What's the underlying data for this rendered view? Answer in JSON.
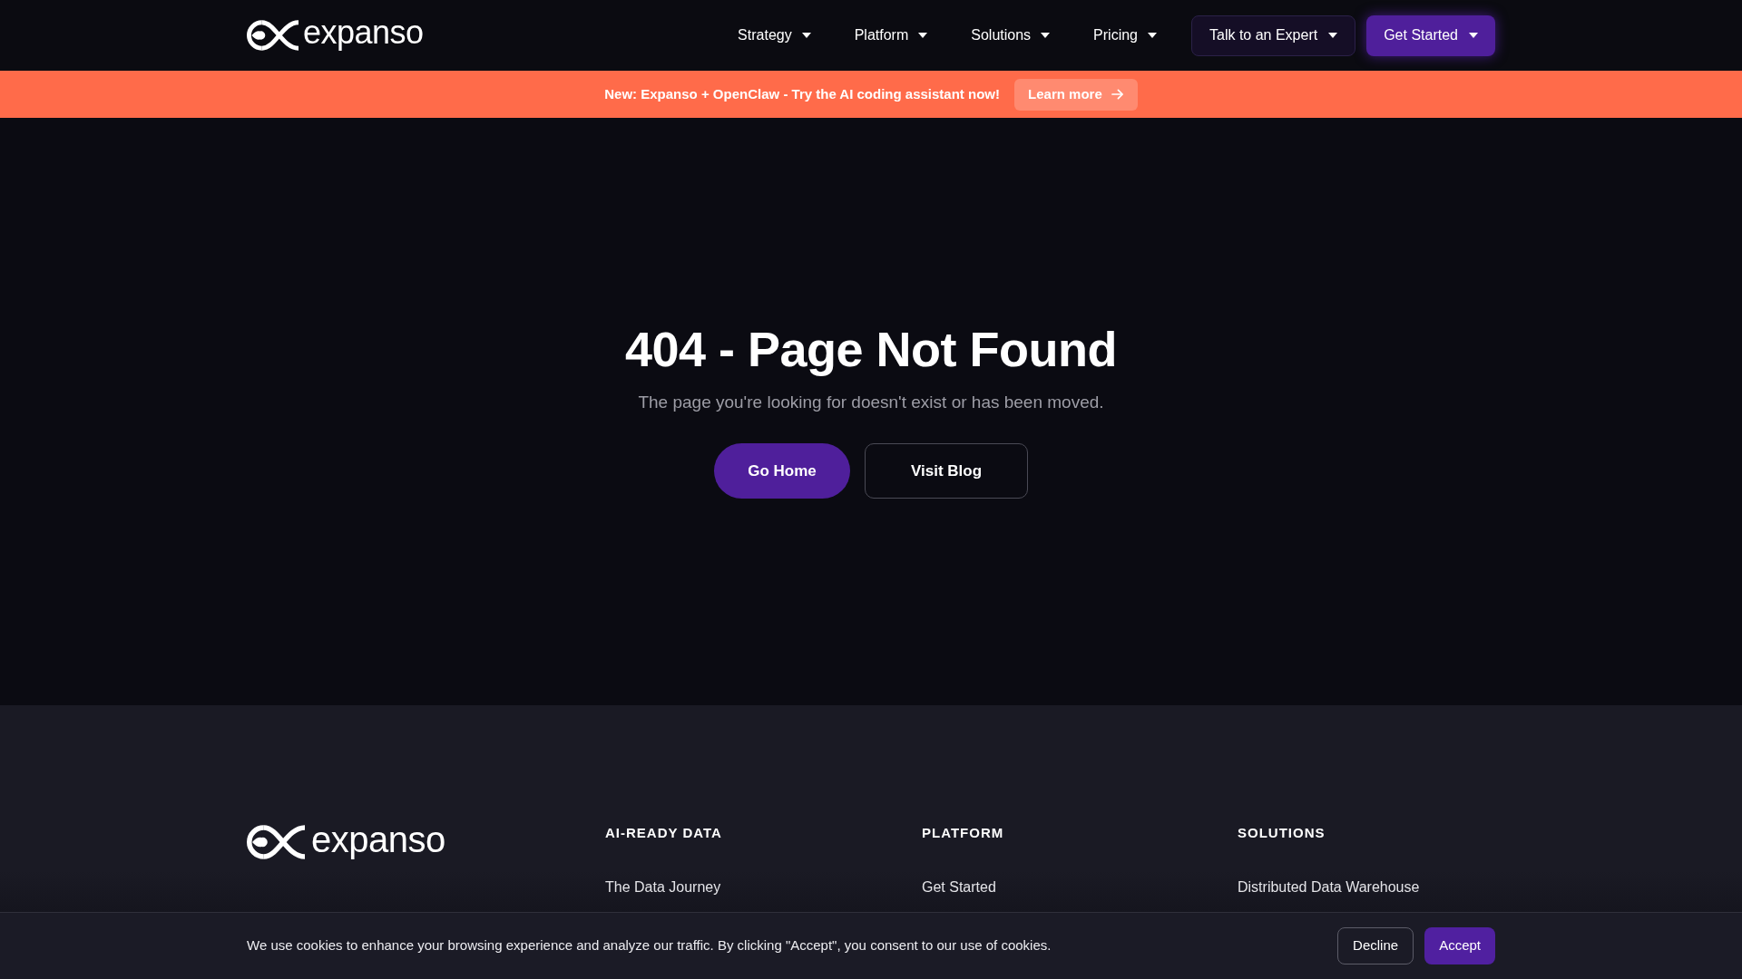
{
  "header": {
    "logo": {
      "text": "expanso"
    },
    "nav": [
      "Strategy",
      "Platform",
      "Solutions",
      "Pricing"
    ],
    "actions": [
      {
        "label": "Talk to an Expert",
        "kind": "secondary"
      },
      {
        "label": "Get Started",
        "kind": "primary"
      }
    ]
  },
  "announcement": {
    "text": "New: Expanso + OpenClaw - Try the AI coding assistant now!",
    "button": "Learn more"
  },
  "main": {
    "title": "404 - Page Not Found",
    "subtitle": "The page you're looking for doesn't exist or has been moved.",
    "buttons": [
      {
        "label": "Go Home",
        "kind": "primary"
      },
      {
        "label": "Visit Blog",
        "kind": "outline"
      }
    ]
  },
  "footer": {
    "logo": {
      "text": "expanso"
    },
    "columns": [
      {
        "heading": "AI-READY DATA",
        "links": [
          "The Data Journey"
        ]
      },
      {
        "heading": "PLATFORM",
        "links": [
          "Get Started"
        ]
      },
      {
        "heading": "SOLUTIONS",
        "links": [
          "Distributed Data Warehouse"
        ]
      }
    ]
  },
  "cookie_banner": {
    "text": "We use cookies to enhance your browsing experience and analyze our traffic. By clicking \"Accept\", you consent to our use of cookies.",
    "buttons": [
      {
        "label": "Decline",
        "kind": "outline"
      },
      {
        "label": "Accept",
        "kind": "primary"
      }
    ]
  }
}
